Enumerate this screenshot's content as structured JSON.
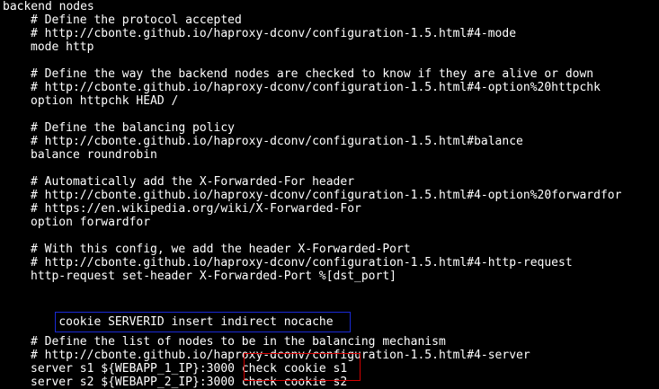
{
  "colors": {
    "background": "#000000",
    "text": "#ffffff",
    "blue_highlight": "#1a2ad6",
    "red_highlight": "#d40000"
  },
  "config": {
    "header": "backend nodes",
    "mode_comment": "# Define the protocol accepted",
    "mode_url": "# http://cbonte.github.io/haproxy-dconv/configuration-1.5.html#4-mode",
    "mode_line": "mode http",
    "check_comment": "# Define the way the backend nodes are checked to know if they are alive or down",
    "check_url": "# http://cbonte.github.io/haproxy-dconv/configuration-1.5.html#4-option%20httpchk",
    "check_line": "option httpchk HEAD /",
    "balance_comment": "# Define the balancing policy",
    "balance_url": "# http://cbonte.github.io/haproxy-dconv/configuration-1.5.html#balance",
    "balance_line": "balance roundrobin",
    "xff_comment": "# Automatically add the X-Forwarded-For header",
    "xff_url": "# http://cbonte.github.io/haproxy-dconv/configuration-1.5.html#4-option%20forwardfor",
    "xff_wiki": "# https://en.wikipedia.org/wiki/X-Forwarded-For",
    "xff_line": "option forwardfor",
    "xfp_comment": "# With this config, we add the header X-Forwarded-Port",
    "xfp_url": "# http://cbonte.github.io/haproxy-dconv/configuration-1.5.html#4-http-request",
    "xfp_line": "http-request set-header X-Forwarded-Port %[dst_port]",
    "cookie_line": "cookie SERVERID insert indirect nocache",
    "servers_comment": "# Define the list of nodes to be in the balancing mechanism",
    "servers_url": "# http://cbonte.github.io/haproxy-dconv/configuration-1.5.html#4-server",
    "server1_prefix": "server s1 ${WEBAPP_1_IP}:3000 ",
    "server1_suffix": "check cookie s1",
    "server2_prefix": "server s2 ${WEBAPP_2_IP}:3000 ",
    "server2_suffix": "check cookie s2"
  }
}
